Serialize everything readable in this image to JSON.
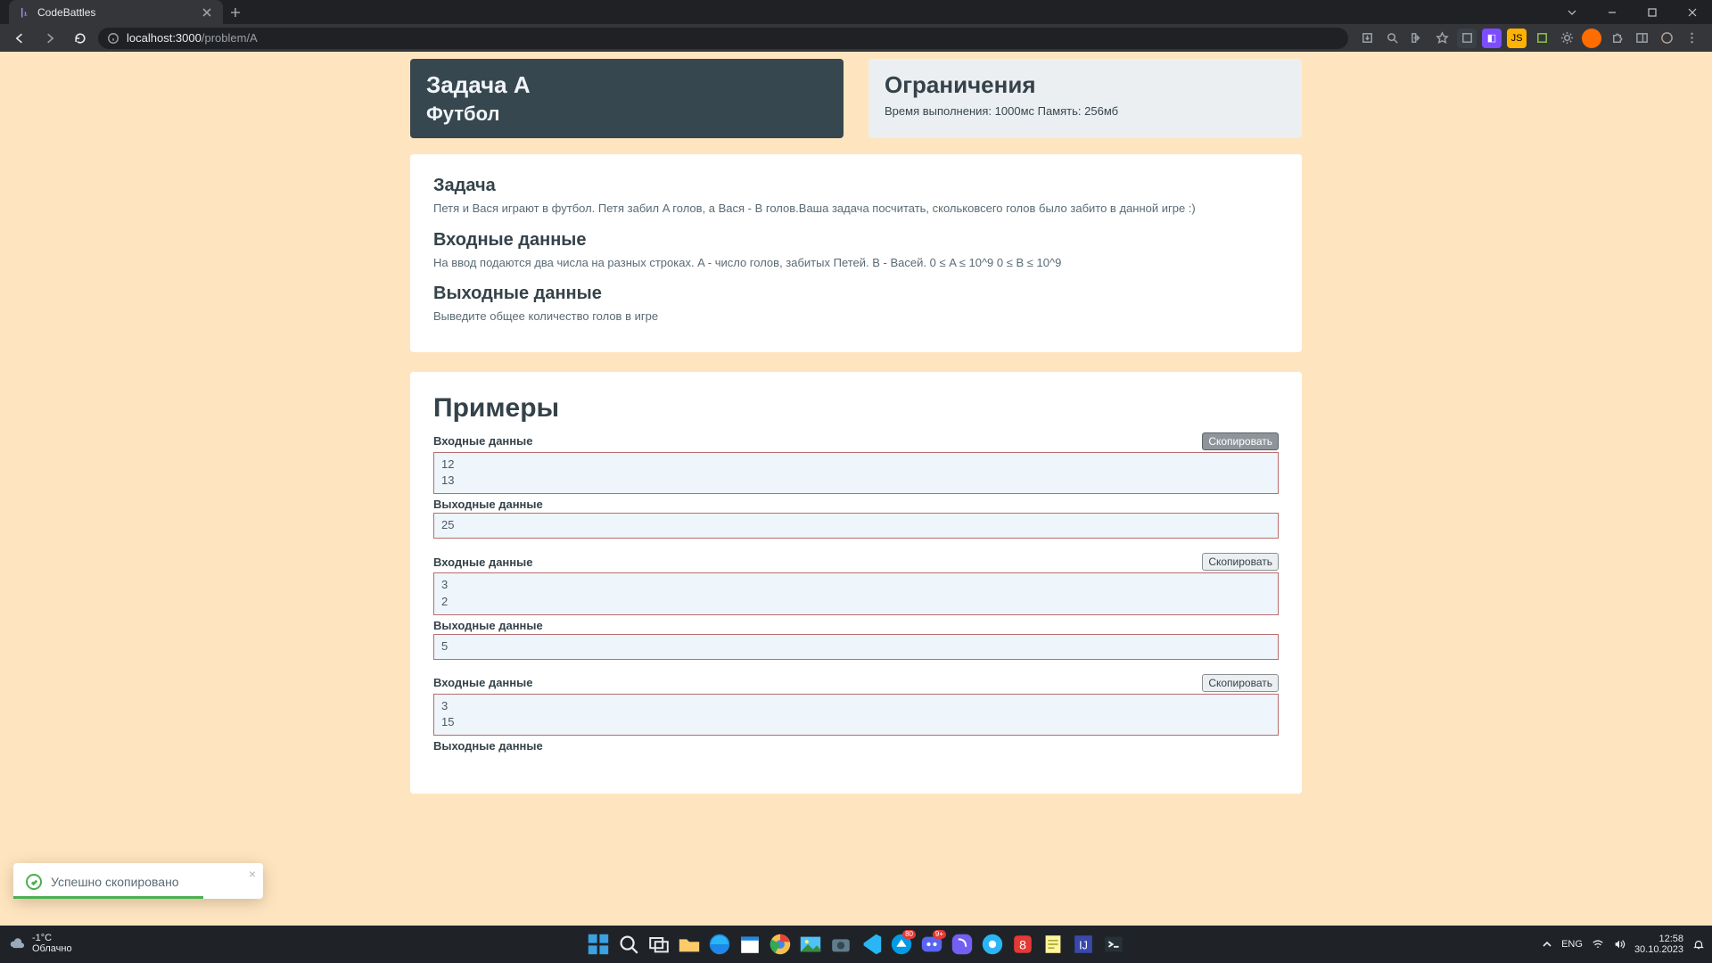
{
  "browser_tab": {
    "title": "CodeBattles",
    "url_host": "localhost",
    "url_port": ":3000",
    "url_path": "/problem/A"
  },
  "header": {
    "task_title": "Задача A",
    "task_subtitle": "Футбол",
    "limits_title": "Ограничения",
    "limits_text": "Время выполнения: 1000мс Память: 256мб"
  },
  "problem": {
    "task_h": "Задача",
    "task_p": "Петя и Вася играют в футбол. Петя забил A голов, а Вася - B голов.Ваша задача посчитать, скольковсего голов было забито в данной игре :)",
    "input_h": "Входные данные",
    "input_p": "На ввод подаются два числа на разных строках. A - число голов, забитых Петей. B - Васей. 0 ≤ A ≤ 10^9 0 ≤ B ≤ 10^9",
    "output_h": "Выходные данные",
    "output_p": "Выведите общее количество голов в игре"
  },
  "examples": {
    "title": "Примеры",
    "input_label": "Входные данные",
    "output_label": "Выходные данные",
    "copy_label": "Скопировать",
    "items": [
      {
        "in": "12\n13",
        "out": "25"
      },
      {
        "in": "3\n2",
        "out": "5"
      },
      {
        "in": "3\n15",
        "out": ""
      }
    ]
  },
  "toast": {
    "text": "Успешно скопировано"
  },
  "taskbar": {
    "weather_temp": "-1°C",
    "weather_desc": "Облачно",
    "lang": "ENG",
    "time": "12:58",
    "date": "30.10.2023",
    "badges": {
      "idx9": "80",
      "idx10": "9+"
    }
  }
}
